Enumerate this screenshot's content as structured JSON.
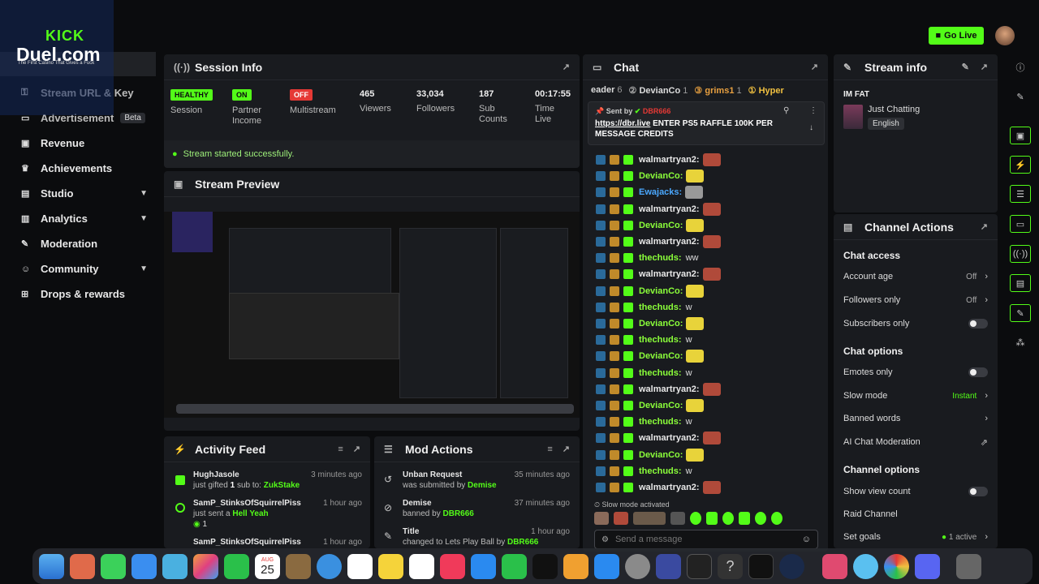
{
  "colors": {
    "kick_green": "#53fc18",
    "red": "#e53935",
    "bg": "#0b0c0e",
    "panel": "#191b1f"
  },
  "header": {
    "go_live": "Go Live",
    "logo_kick": "KICK",
    "logo_duel": "Duel.com",
    "logo_tagline": "The First Casino That Gives a Fuck"
  },
  "sidebar": {
    "items": [
      {
        "label": "Stream URL & Key",
        "icon": "key-icon"
      },
      {
        "label": "Advertisement",
        "icon": "ad-icon",
        "badge": "Beta"
      },
      {
        "label": "Revenue",
        "icon": "money-icon"
      },
      {
        "label": "Achievements",
        "icon": "trophy-icon"
      },
      {
        "label": "Studio",
        "icon": "studio-icon"
      },
      {
        "label": "Analytics",
        "icon": "chart-icon"
      },
      {
        "label": "Moderation",
        "icon": "wrench-icon"
      },
      {
        "label": "Community",
        "icon": "people-icon"
      },
      {
        "label": "Drops & rewards",
        "icon": "gift-icon"
      }
    ]
  },
  "session": {
    "title": "Session Info",
    "status_msg": "Stream started successfully.",
    "stats": [
      {
        "badge": "HEALTHY",
        "label": "Session"
      },
      {
        "badge": "ON",
        "label": "Partner Income"
      },
      {
        "badge": "OFF",
        "label": "Multistream"
      },
      {
        "value": "465",
        "label": "Viewers"
      },
      {
        "value": "33,034",
        "label": "Followers"
      },
      {
        "value": "187",
        "label": "Sub Counts"
      },
      {
        "value": "00:17:55",
        "label": "Time Live"
      }
    ]
  },
  "preview": {
    "title": "Stream Preview"
  },
  "activity": {
    "title": "Activity Feed",
    "items": [
      {
        "user": "HughJasole",
        "action": "just gifted",
        "count": "1",
        "mid": "sub to:",
        "target": "ZukStake",
        "time": "3 minutes ago"
      },
      {
        "user": "SamP_StinksOfSquirrelPiss",
        "action": "just sent a",
        "target": "Hell Yeah",
        "extra": "1",
        "time": "1 hour ago"
      },
      {
        "user": "SamP_StinksOfSquirrelPiss",
        "time": "1 hour ago"
      }
    ]
  },
  "mod": {
    "title": "Mod Actions",
    "items": [
      {
        "title": "Unban Request",
        "desc": "was submitted by",
        "by": "Demise",
        "time": "35 minutes ago"
      },
      {
        "title": "Demise",
        "desc": "banned by",
        "by": "DBR666",
        "time": "37 minutes ago"
      },
      {
        "title": "Title",
        "desc": "changed to Lets Play Ball by",
        "by": "DBR666",
        "time": "1 hour ago"
      }
    ]
  },
  "chat": {
    "title": "Chat",
    "leaderboard": [
      {
        "name": "eader",
        "count": "6"
      },
      {
        "name": "DevianCo",
        "count": "1"
      },
      {
        "name": "grims1",
        "count": "1"
      },
      {
        "name": "Hyper",
        "count": ""
      }
    ],
    "pinned": {
      "sent_by": "Sent by",
      "user": "DBR666",
      "text": "https://dbr.live ENTER PS5 RAFFLE 100K PER MESSAGE CREDITS",
      "link": "https://dbr.live",
      "rest": " ENTER PS5 RAFFLE 100K PER MESSAGE CREDITS"
    },
    "messages": [
      {
        "user": "walmartryan2:",
        "text": "",
        "color": "#e8e8e8",
        "emote": "#b04a3a"
      },
      {
        "user": "DevianCo:",
        "text": "",
        "color": "#8bff3a",
        "emote": "#e8d33a"
      },
      {
        "user": "Ewajacks:",
        "text": "",
        "color": "#4aa8ff",
        "emote": "#999"
      },
      {
        "user": "walmartryan2:",
        "text": "",
        "color": "#e8e8e8",
        "emote": "#b04a3a"
      },
      {
        "user": "DevianCo:",
        "text": "",
        "color": "#8bff3a",
        "emote": "#e8d33a"
      },
      {
        "user": "walmartryan2:",
        "text": "",
        "color": "#e8e8e8",
        "emote": "#b04a3a"
      },
      {
        "user": "thechuds:",
        "text": "ww",
        "color": "#8bff3a"
      },
      {
        "user": "walmartryan2:",
        "text": "",
        "color": "#e8e8e8",
        "emote": "#b04a3a"
      },
      {
        "user": "DevianCo:",
        "text": "",
        "color": "#8bff3a",
        "emote": "#e8d33a"
      },
      {
        "user": "thechuds:",
        "text": "w",
        "color": "#8bff3a"
      },
      {
        "user": "DevianCo:",
        "text": "",
        "color": "#8bff3a",
        "emote": "#e8d33a"
      },
      {
        "user": "thechuds:",
        "text": "w",
        "color": "#8bff3a"
      },
      {
        "user": "DevianCo:",
        "text": "",
        "color": "#8bff3a",
        "emote": "#e8d33a"
      },
      {
        "user": "thechuds:",
        "text": "w",
        "color": "#8bff3a"
      },
      {
        "user": "walmartryan2:",
        "text": "",
        "color": "#e8e8e8",
        "emote": "#b04a3a"
      },
      {
        "user": "DevianCo:",
        "text": "",
        "color": "#8bff3a",
        "emote": "#e8d33a"
      },
      {
        "user": "thechuds:",
        "text": "w",
        "color": "#8bff3a"
      },
      {
        "user": "walmartryan2:",
        "text": "",
        "color": "#e8e8e8",
        "emote": "#b04a3a"
      },
      {
        "user": "DevianCo:",
        "text": "",
        "color": "#8bff3a",
        "emote": "#e8d33a"
      },
      {
        "user": "thechuds:",
        "text": "w",
        "color": "#8bff3a"
      },
      {
        "user": "walmartryan2:",
        "text": "",
        "color": "#e8e8e8",
        "emote": "#b04a3a"
      }
    ],
    "slow_mode": "Slow mode activated",
    "placeholder": "Send a message"
  },
  "stream_info": {
    "title": "Stream info",
    "stream_title": "IM FAT",
    "category": "Just Chatting",
    "language": "English"
  },
  "channel_actions": {
    "title": "Channel Actions",
    "chat_access": "Chat access",
    "account_age": "Account age",
    "account_age_val": "Off",
    "followers_only": "Followers only",
    "followers_only_val": "Off",
    "subscribers_only": "Subscribers only",
    "chat_options": "Chat options",
    "emotes_only": "Emotes only",
    "slow_mode": "Slow mode",
    "slow_mode_val": "Instant",
    "banned_words": "Banned words",
    "ai_mod": "AI Chat Moderation",
    "channel_options": "Channel options",
    "show_view_count": "Show view count",
    "raid": "Raid Channel",
    "goals": "Set goals",
    "goals_val": "1 active"
  },
  "dock": {
    "calendar_month": "AUG",
    "calendar_day": "25"
  }
}
